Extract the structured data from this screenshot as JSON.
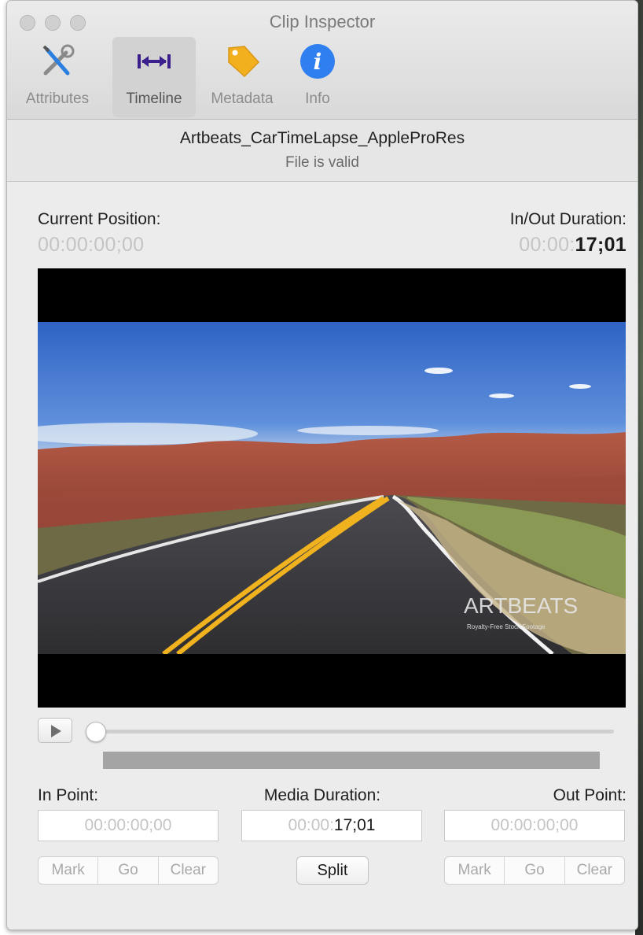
{
  "window": {
    "title": "Clip Inspector"
  },
  "toolbar": {
    "items": [
      {
        "label": "Attributes",
        "icon": "wrench-screwdriver-icon"
      },
      {
        "label": "Timeline",
        "icon": "double-arrow-icon",
        "active": true
      },
      {
        "label": "Metadata",
        "icon": "tag-icon"
      },
      {
        "label": "Info",
        "icon": "info-icon"
      }
    ]
  },
  "clip": {
    "name": "Artbeats_CarTimeLapse_AppleProRes",
    "status": "File is valid"
  },
  "position": {
    "current_label": "Current Position:",
    "current_value": "00:00:00;00",
    "inout_label": "In/Out Duration:",
    "inout_dim": "00:00:",
    "inout_strong": "17;01"
  },
  "video": {
    "watermark": "ARTBEATS",
    "watermark_sub": "Royalty-Free Stock Footage"
  },
  "playback": {
    "scrub_position": 0.0
  },
  "points": {
    "in_label": "In Point:",
    "in_value": "00:00:00;00",
    "media_label": "Media Duration:",
    "media_dim": "00:00:",
    "media_strong": "17;01",
    "out_label": "Out Point:",
    "out_value": "00:00:00;00"
  },
  "buttons": {
    "mark": "Mark",
    "go": "Go",
    "clear": "Clear",
    "split": "Split"
  },
  "colors": {
    "window_bg": "#ececec",
    "timeline_icon": "#3b1f8c",
    "tag_icon": "#f2b01e",
    "info_icon": "#2f7ff0"
  }
}
